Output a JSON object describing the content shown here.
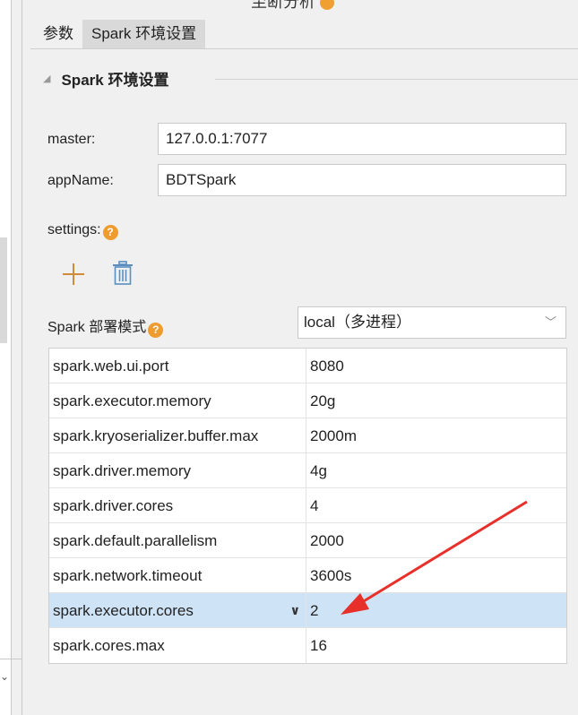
{
  "panel": {
    "title_partial": "至断分析"
  },
  "tabs": [
    {
      "label": "参数",
      "active": false
    },
    {
      "label": "Spark 环境设置",
      "active": true
    }
  ],
  "section": {
    "title": "Spark 环境设置"
  },
  "fields": {
    "master_label": "master:",
    "master_value": "127.0.0.1:7077",
    "appname_label": "appName:",
    "appname_value": "BDTSpark",
    "settings_label": "settings:",
    "deploy_label": "Spark 部署模式",
    "deploy_value": "local（多进程）"
  },
  "help_icon": "?",
  "icons": {
    "add": "plus-icon",
    "delete": "trash-icon",
    "help": "question-circle-icon",
    "dropdown": "chevron-down-icon"
  },
  "settings_table": {
    "rows": [
      {
        "key": "spark.web.ui.port",
        "value": "8080"
      },
      {
        "key": "spark.executor.memory",
        "value": "20g"
      },
      {
        "key": "spark.kryoserializer.buffer.max",
        "value": "2000m"
      },
      {
        "key": "spark.driver.memory",
        "value": "4g"
      },
      {
        "key": "spark.driver.cores",
        "value": "4"
      },
      {
        "key": "spark.default.parallelism",
        "value": "2000"
      },
      {
        "key": "spark.network.timeout",
        "value": "3600s"
      },
      {
        "key": "spark.executor.cores",
        "value": "2",
        "selected": true
      },
      {
        "key": "spark.cores.max",
        "value": "16"
      }
    ]
  },
  "colors": {
    "accent_orange": "#ee9c30",
    "selected_row": "#cfe3f7",
    "annotation_arrow": "#e8302a"
  }
}
